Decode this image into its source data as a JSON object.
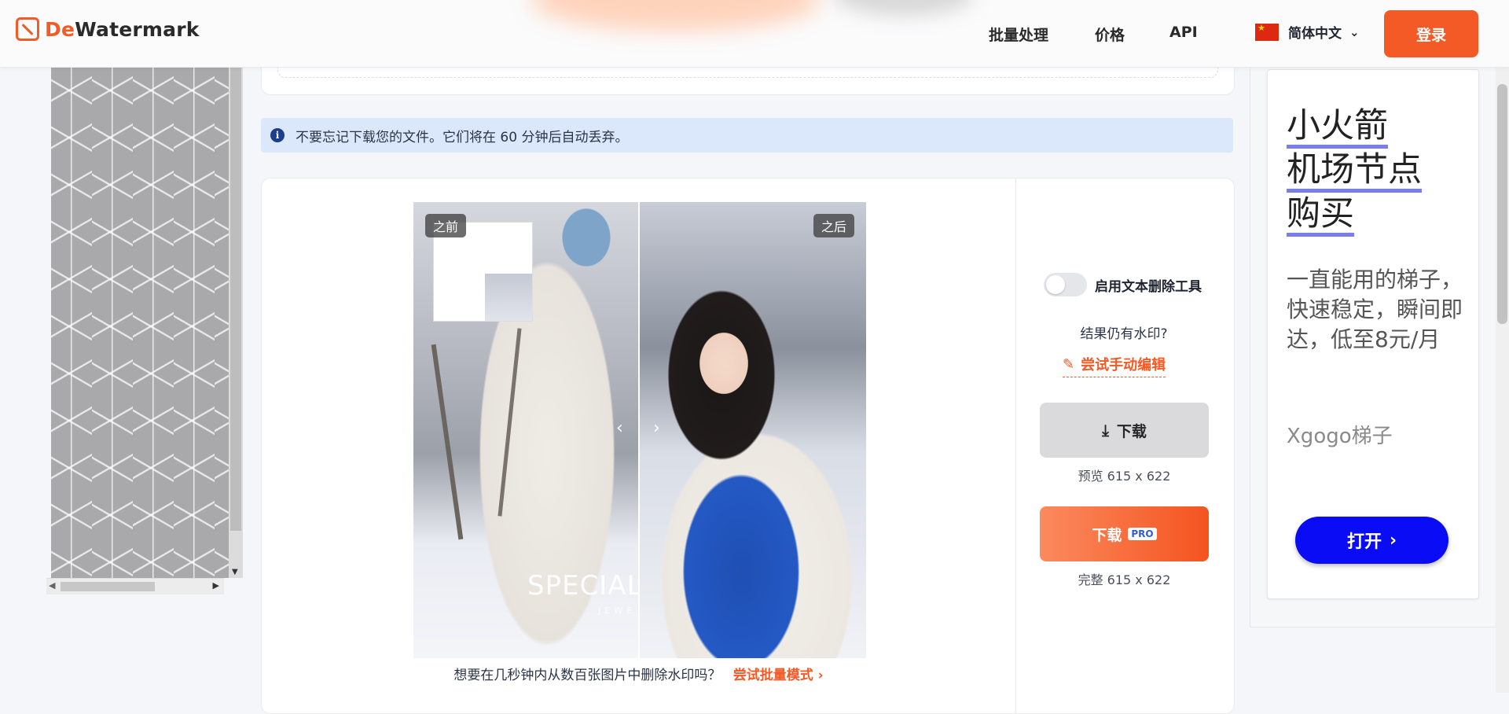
{
  "header": {
    "logo_de": "De",
    "logo_wm": "Watermark",
    "nav": [
      {
        "label": "批量处理"
      },
      {
        "label": "价格"
      },
      {
        "label": "API"
      }
    ],
    "language": "简体中文",
    "login": "登录"
  },
  "notice": {
    "icon": "info-icon",
    "text": "不要忘记下载您的文件。它们将在 60 分钟后自动丢弃。"
  },
  "compare": {
    "before_label": "之前",
    "after_label": "之后",
    "watermark_text": "SPECIALC",
    "watermark_sub": "JEWE"
  },
  "cta": {
    "text": "想要在几秒钟内从数百张图片中删除水印吗？",
    "link": "尝试批量模式",
    "link_chevron": "›"
  },
  "tools": {
    "toggle_label": "启用文本删除工具",
    "toggle_on": false,
    "question": "结果仍有水印?",
    "manual_edit": "尝试手动编辑",
    "download_label": "下载",
    "preview_size": "预览 615 x 622",
    "download_pro_label": "下载",
    "pro_badge": "PRO",
    "full_size": "完整 615 x 622"
  },
  "ad": {
    "title_lines": [
      "小火箭",
      "机场节点",
      "购买"
    ],
    "body": "一直能用的梯子，快速稳定，瞬间即达，低至8元/月",
    "brand": "Xgogo梯子",
    "button": "打开"
  },
  "colors": {
    "brand": "#f45a25",
    "ad_button": "#0a0cf5",
    "notice_bg": "#dbe7fb"
  }
}
